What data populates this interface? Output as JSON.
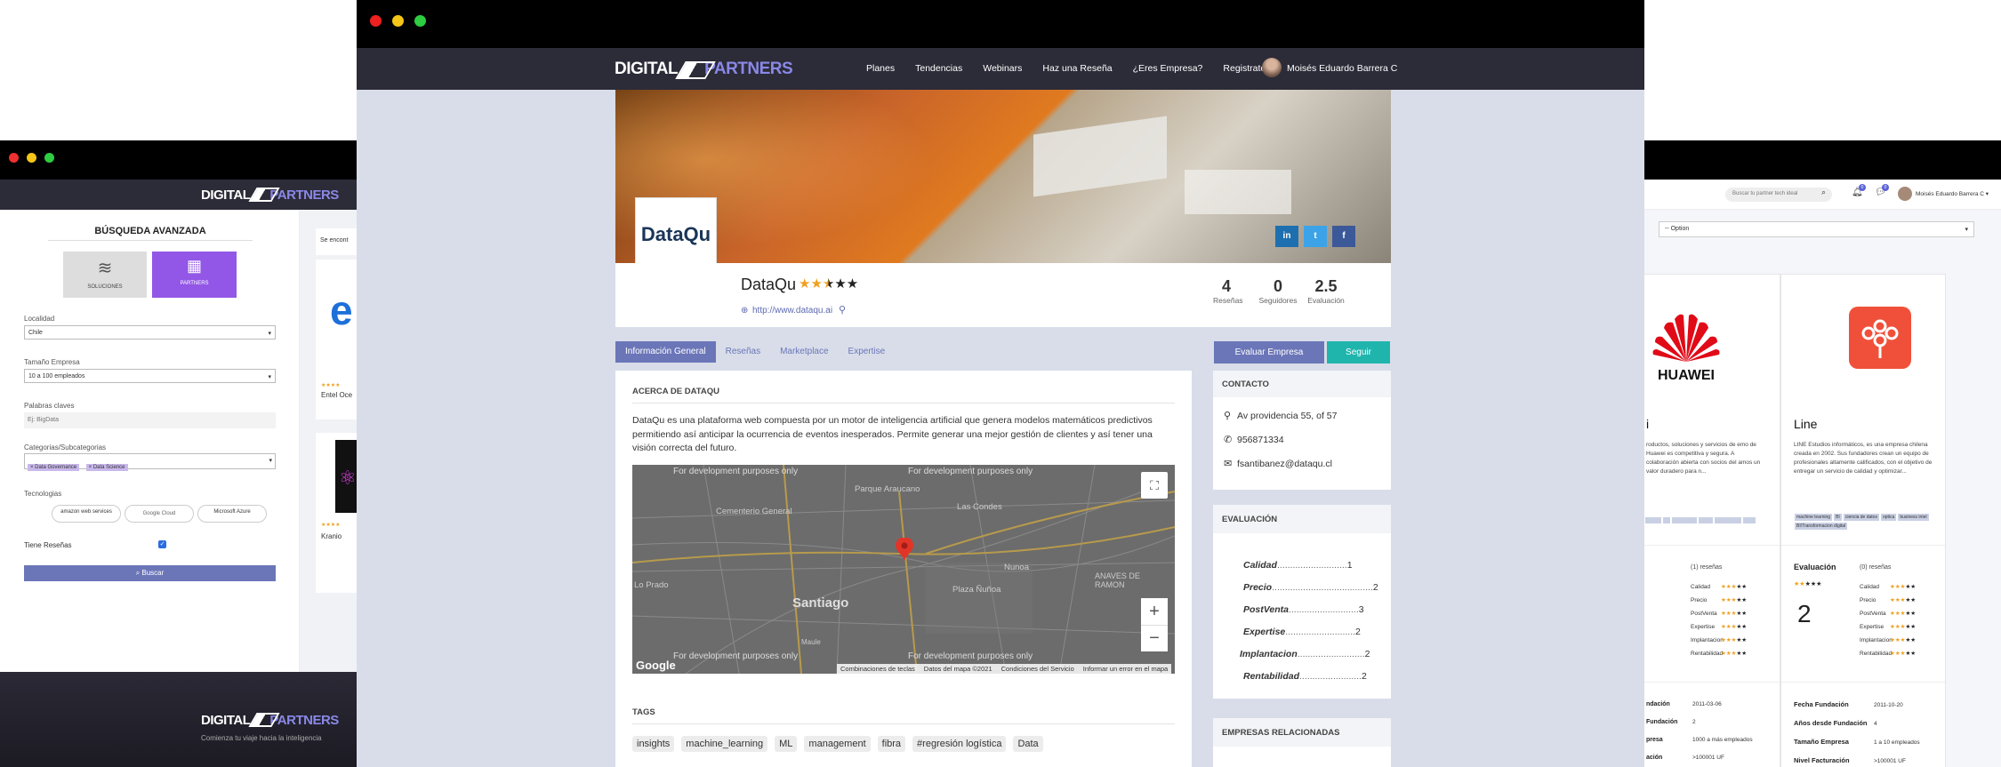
{
  "main_nav": {
    "brand_left": "DIGITAL",
    "brand_right": "PARTNERS",
    "items": [
      "Planes",
      "Tendencias",
      "Webinars",
      "Haz una Reseña",
      "¿Eres Empresa?",
      "Registrate"
    ],
    "user": "Moisés Eduardo Barrera C"
  },
  "company": {
    "logo_text": "DataQu",
    "name": "DataQu",
    "rating": 2.5,
    "url": "http://www.dataqu.ai",
    "stats": [
      {
        "value": "4",
        "label": "Reseñas"
      },
      {
        "value": "0",
        "label": "Seguidores"
      },
      {
        "value": "2.5",
        "label": "Evaluación"
      }
    ],
    "social": [
      "in",
      "t",
      "f"
    ]
  },
  "tabs": [
    "Información General",
    "Reseñas",
    "Marketplace",
    "Expertise"
  ],
  "actions": {
    "evaluate": "Evaluar Empresa",
    "follow": "Seguir"
  },
  "about": {
    "title": "ACERCA DE DATAQU",
    "text": "DataQu es una plataforma web compuesta por un motor de inteligencia artificial que genera modelos matemáticos predictivos permitiendo así anticipar la ocurrencia de eventos inesperados. Permite generar una mejor gestión de clientes y así tener una visión correcta del futuro."
  },
  "map": {
    "watermark": "For development purposes only",
    "places": [
      "Parque Araucano",
      "Cementerio General",
      "Las Condes",
      "Santiago",
      "Plaza Ñuñoa",
      "Nunoa",
      "Lo Prado",
      "Maule",
      "ANAVES DE RAMON"
    ],
    "footer": [
      "Combinaciones de teclas",
      "Datos del mapa ©2021",
      "Condiciones del Servicio",
      "Informar un error en el mapa"
    ],
    "google": "Google"
  },
  "tags": {
    "title": "TAGS",
    "items": [
      "insights",
      "machine_learning",
      "ML",
      "management",
      "fibra",
      "#regresión logística",
      "Data"
    ]
  },
  "contact": {
    "title": "CONTACTO",
    "address": "Av providencia 55, of 57",
    "phone": "956871334",
    "email": "fsantibanez@dataqu.cl"
  },
  "evaluation": {
    "title": "EVALUACIÓN",
    "rows": [
      {
        "label": "Calidad",
        "value": "1"
      },
      {
        "label": "Precio",
        "value": "2"
      },
      {
        "label": "PostVenta",
        "value": "3"
      },
      {
        "label": "Expertise",
        "value": "2"
      },
      {
        "label": "Implantacion",
        "value": "2"
      },
      {
        "label": "Rentabilidad",
        "value": "2"
      }
    ]
  },
  "related": {
    "title": "EMPRESAS RELACIONADAS"
  },
  "left_window": {
    "title": "BÚSQUEDA AVANZADA",
    "toggle": [
      {
        "label": "SOLUCIONES"
      },
      {
        "label": "PARTNERS"
      }
    ],
    "fields": [
      {
        "label": "Localidad",
        "value": "Chile"
      },
      {
        "label": "Tamaño Empresa",
        "value": "10 a 100 empleados"
      },
      {
        "label": "Palabras claves",
        "value": "Ej: BigData"
      }
    ],
    "categories_label": "Categorias/Subcategorias",
    "categories": [
      "× Data Governance",
      "× Data Science"
    ],
    "tech_label": "Tecnologias",
    "tech": [
      "amazon web services",
      "Google Cloud",
      "Microsoft Azure"
    ],
    "reviews_label": "Tiene Reseñas",
    "search_btn": "Buscar",
    "results_text": "Se encont",
    "result_names": [
      "Entel Oce",
      "Kranio"
    ],
    "footer_tagline": "Comienza tu viaje hacia la inteligencia"
  },
  "right_window": {
    "search_placeholder": "Buscar tu partner tech ideal",
    "user": "Moisés Eduardo Barrera C",
    "select": "-- Option",
    "badge1": "0",
    "badge2": "0",
    "cards": [
      {
        "brand": "HUAWEI",
        "name": "i",
        "desc": "roductos, soluciones y servicios de emo de Huawei es competitiva y segura. A colaboración abierta con socios del amos un valor duradero para n...",
        "tags": [
          "",
          "",
          "",
          "",
          ""
        ],
        "eval_label": "",
        "reviews": "(1) reseñas",
        "score": "",
        "criteria": [
          "Calidad",
          "Precio",
          "PostVenta",
          "Expertise",
          "Implantacion",
          "Rentabilidad"
        ],
        "facts": [
          {
            "k": "ndación",
            "v": "2011-03-06"
          },
          {
            "k": "Fundación",
            "v": "2"
          },
          {
            "k": "presa",
            "v": "1000 a más empleados"
          },
          {
            "k": "ación",
            "v": ">100001 UF"
          }
        ]
      },
      {
        "brand": "",
        "name": "Line",
        "desc": "LINE Estudios informáticos, es una empresa chilena creada en 2002. Sus fundadores crean un equipo de profesionales altamente calificados, con el objetivo de entregar un servicio de calidad y optimizar...",
        "tags": [
          "machine learning",
          "BI",
          "ciencia de datos",
          "optica",
          "business intel",
          "BI/Transformacion digital"
        ],
        "eval_label": "Evaluación",
        "reviews": "(0) reseñas",
        "score": "2",
        "criteria": [
          "Calidad",
          "Precio",
          "PostVenta",
          "Expertise",
          "Implantacion",
          "Rentabilidad"
        ],
        "facts": [
          {
            "k": "Fecha Fundación",
            "v": "2011-10-20"
          },
          {
            "k": "Años desde Fundación",
            "v": "4"
          },
          {
            "k": "Tamaño Empresa",
            "v": "1 a 10 empleados"
          },
          {
            "k": "Nivel Facturación",
            "v": ">100001 UF"
          }
        ]
      }
    ]
  }
}
